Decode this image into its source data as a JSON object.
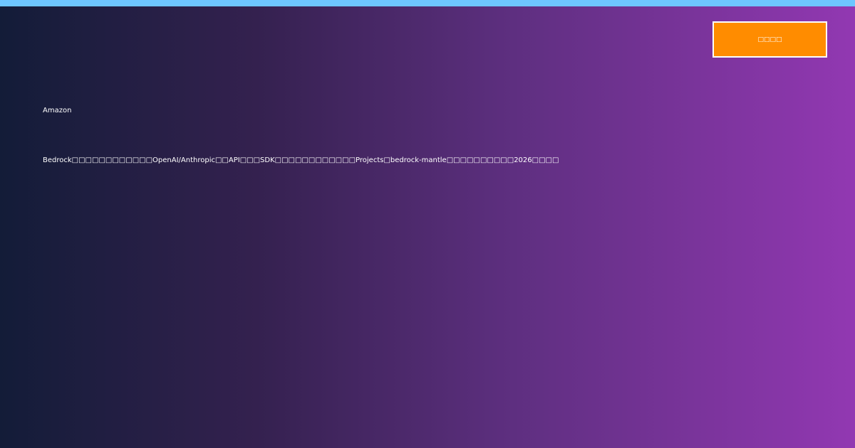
{
  "colors": {
    "top_strip": "#6ec6ff",
    "badge_background": "#ff8c00",
    "badge_border": "#ffffff",
    "gradient_start": "#131c38",
    "gradient_end": "#9238b2",
    "text": "#ffffff"
  },
  "badge": {
    "label": "□□□□"
  },
  "eyebrow": {
    "text": "Amazon"
  },
  "headline": {
    "text": "Bedrock□□□□□□□□□□□□OpenAI/Anthropic□□API□□□SDK□□□□□□□□□□□□Projects□bedrock-mantle□□□□□□□□□□2026□□□□"
  }
}
